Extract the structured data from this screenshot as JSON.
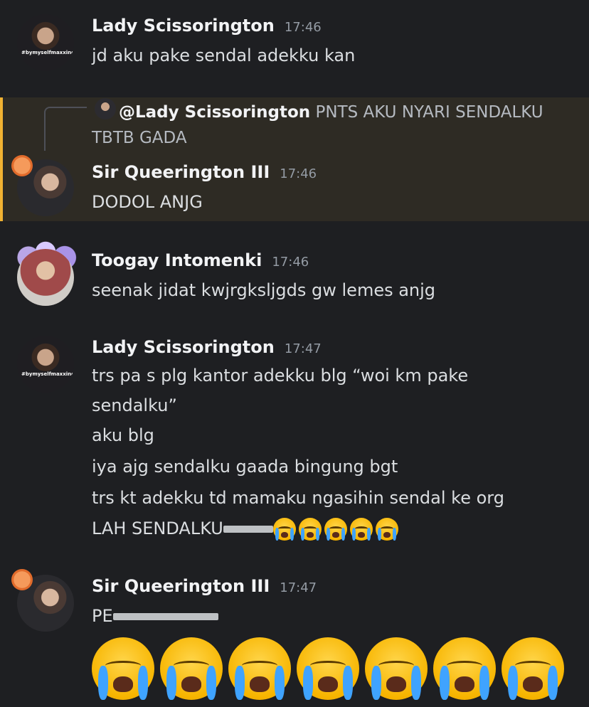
{
  "messages": [
    {
      "author": "Lady Scissorington",
      "time": "17:46",
      "avatar_caption": "#bymyselfmaxxing",
      "lines": [
        "jd aku pake sendal adekku kan"
      ]
    },
    {
      "reply_to": {
        "user": "@Lady Scissorington",
        "text_line1": "PNTS AKU NYARI SENDALKU",
        "text_line2": "TBTB GADA"
      },
      "author": "Sir Queerington III",
      "time": "17:46",
      "lines": [
        "DODOL ANJG"
      ]
    },
    {
      "author": "Toogay Intomenki",
      "time": "17:46",
      "lines": [
        "seenak jidat kwjrgksljgds gw lemes anjg"
      ]
    },
    {
      "author": "Lady Scissorington",
      "time": "17:47",
      "avatar_caption": "#bymyselfmaxxing",
      "lines": [
        "trs pa s plg kantor adekku blg “woi km pake",
        "sendalku”",
        "aku blg",
        "iya ajg sendalku gaada bingung bgt",
        "trs kt adekku td mamaku ngasihin sendal ke org",
        "LAH SENDALKU"
      ]
    },
    {
      "author": "Sir Queerington III",
      "time": "17:47",
      "lines": [
        "PE"
      ]
    }
  ],
  "emoji": {
    "name": "loudly-crying-face",
    "inline_count": 5,
    "jumbo_count": 7
  },
  "colors": {
    "background": "#1e1f22",
    "highlight_background": "#2e2b24",
    "highlight_border": "#f0b232",
    "username": "#f2f3f5",
    "text": "#dbdee1",
    "timestamp": "#949ba4"
  }
}
